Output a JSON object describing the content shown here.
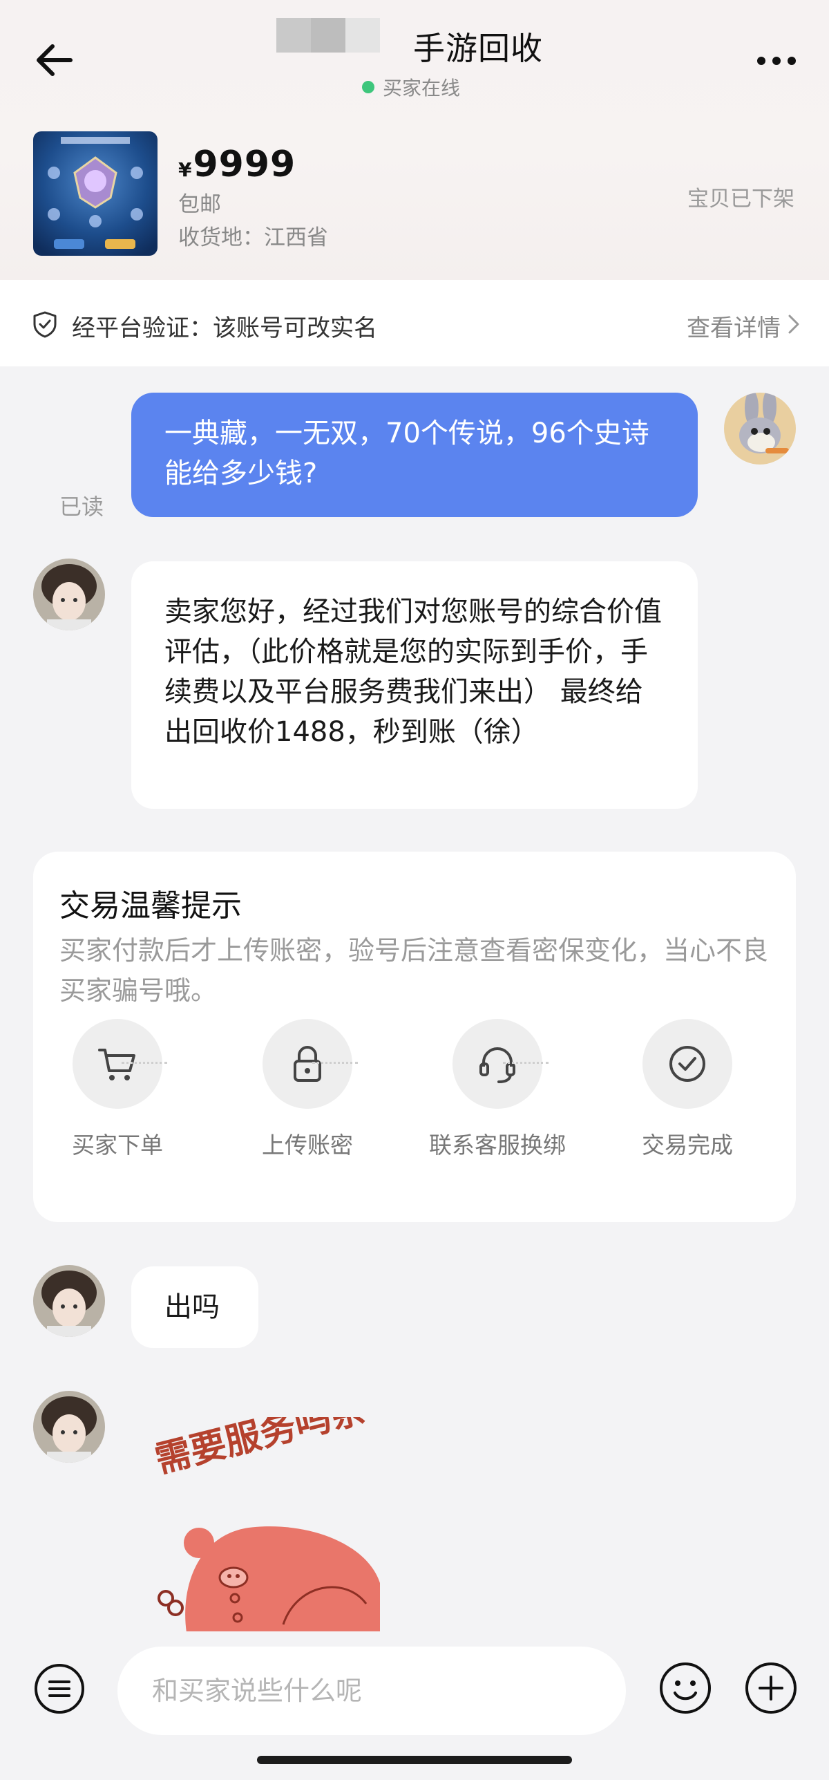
{
  "header": {
    "title": "手游回收",
    "status": "买家在线",
    "back_icon": "arrow-left-icon",
    "more_icon": "more-horizontal-icon"
  },
  "product": {
    "currency": "¥",
    "price": "9999",
    "shipping": "包邮",
    "location": "收货地：江西省",
    "status": "宝贝已下架"
  },
  "verify": {
    "text": "经平台验证：该账号可改实名",
    "link": "查看详情",
    "icon": "shield-check-icon"
  },
  "messages": {
    "m1_text": "一典藏，一无双，70个传说，96个史诗 能给多少钱?",
    "m1_read": "已读",
    "m2_text": "卖家您好，经过我们对您账号的综合价值评估，（此价格就是您的实际到手价，手续费以及平台服务费我们来出） 最终给出回收价1488，秒到账（徐）",
    "m3_text": "出吗"
  },
  "tips": {
    "title": "交易温馨提示",
    "desc": "买家付款后才上传账密，验号后注意查看密保变化，当心不良买家骗号哦。",
    "steps": [
      {
        "label": "买家下单",
        "icon": "cart-icon"
      },
      {
        "label": "上传账密",
        "icon": "lock-icon"
      },
      {
        "label": "联系客服换绑",
        "icon": "headset-icon"
      },
      {
        "label": "交易完成",
        "icon": "check-circle-icon"
      }
    ]
  },
  "sticker": {
    "text": "需要服务吗亲"
  },
  "input": {
    "placeholder": "和买家说些什么呢"
  },
  "colors": {
    "accent_blue": "#5b84ef",
    "online_green": "#3ec67c",
    "background": "#f3f3f5"
  }
}
